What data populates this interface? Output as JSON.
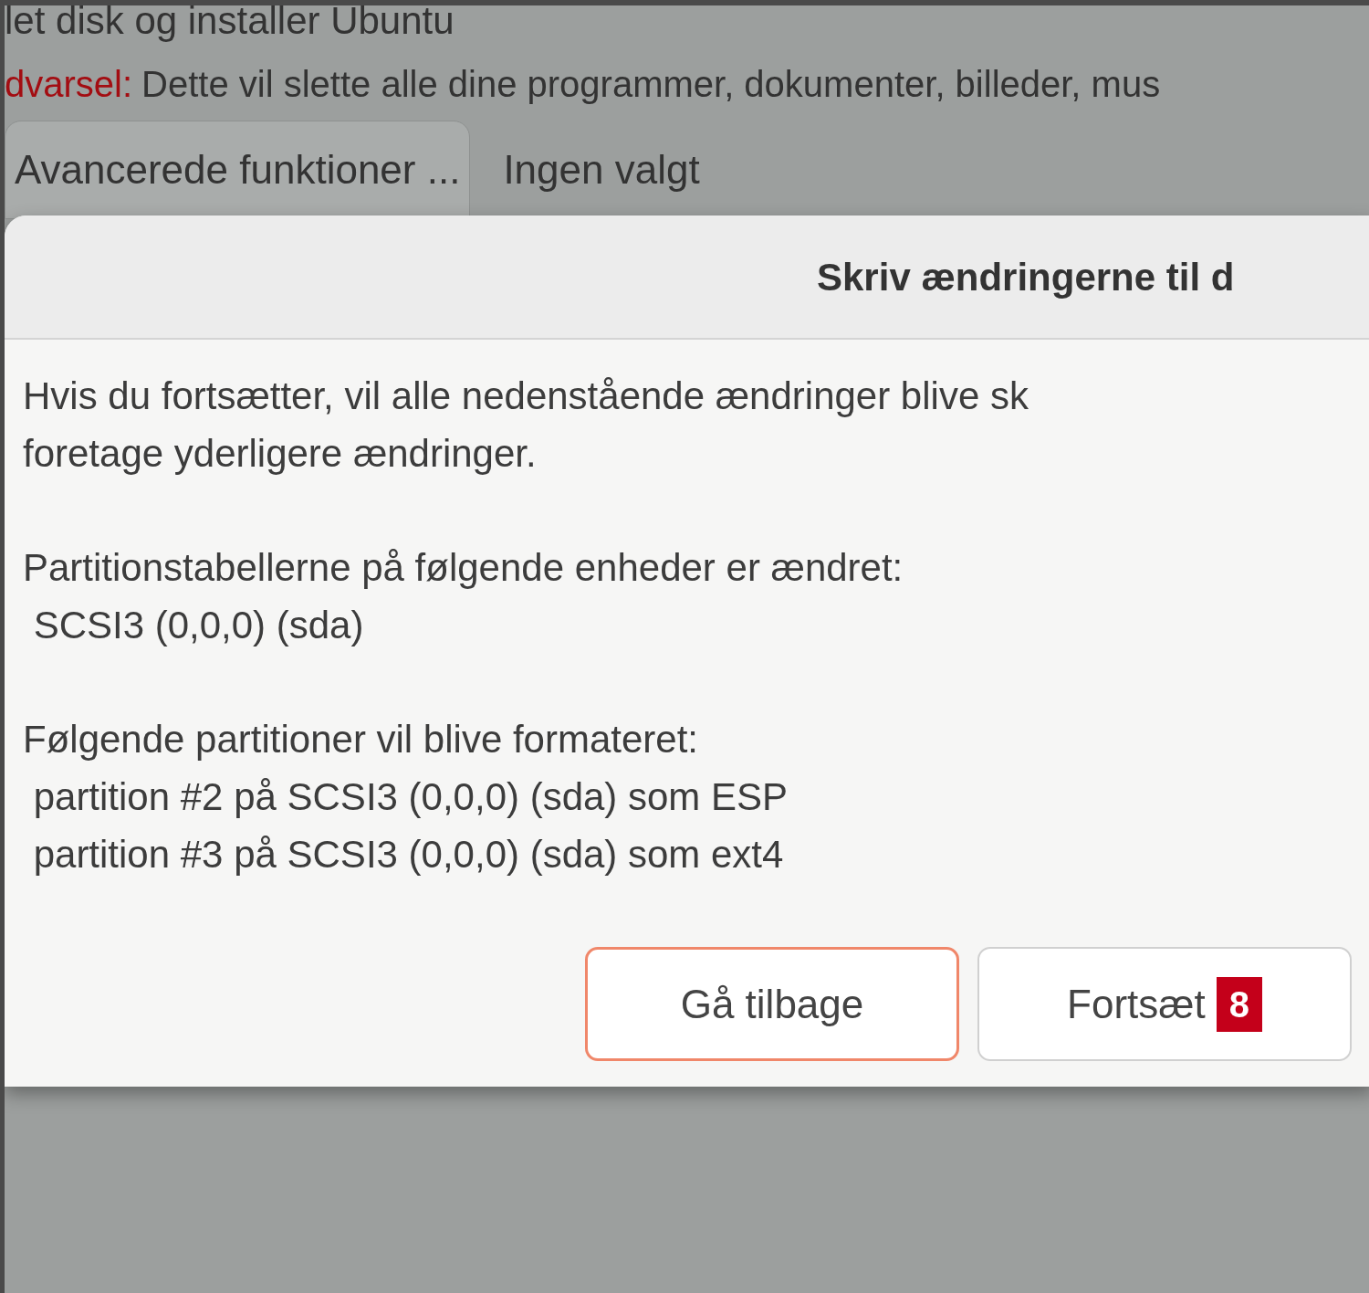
{
  "heading": "let disk og installer Ubuntu",
  "warning": {
    "label": "dvarsel:",
    "text": "Dette vil slette alle dine programmer, dokumenter, billeder, mus"
  },
  "advanced_button": "Avancerede funktioner ...",
  "advanced_status": "Ingen valgt",
  "dialog": {
    "title": "Skriv ændringerne til d",
    "paragraphs": [
      {
        "lines": [
          "Hvis du fortsætter, vil alle nedenstående ændringer blive sk",
          "foretage yderligere ændringer."
        ]
      },
      {
        "lines": [
          "Partitionstabellerne på følgende enheder er ændret:",
          " SCSI3 (0,0,0) (sda)"
        ]
      },
      {
        "lines": [
          "Følgende partitioner vil blive formateret:",
          " partition #2 på SCSI3 (0,0,0) (sda) som ESP",
          " partition #3 på SCSI3 (0,0,0) (sda) som ext4"
        ]
      }
    ],
    "buttons": [
      {
        "label": "Gå tilbage",
        "focused": true
      },
      {
        "label": "Fortsæt",
        "focused": false,
        "badge": "8"
      }
    ]
  }
}
